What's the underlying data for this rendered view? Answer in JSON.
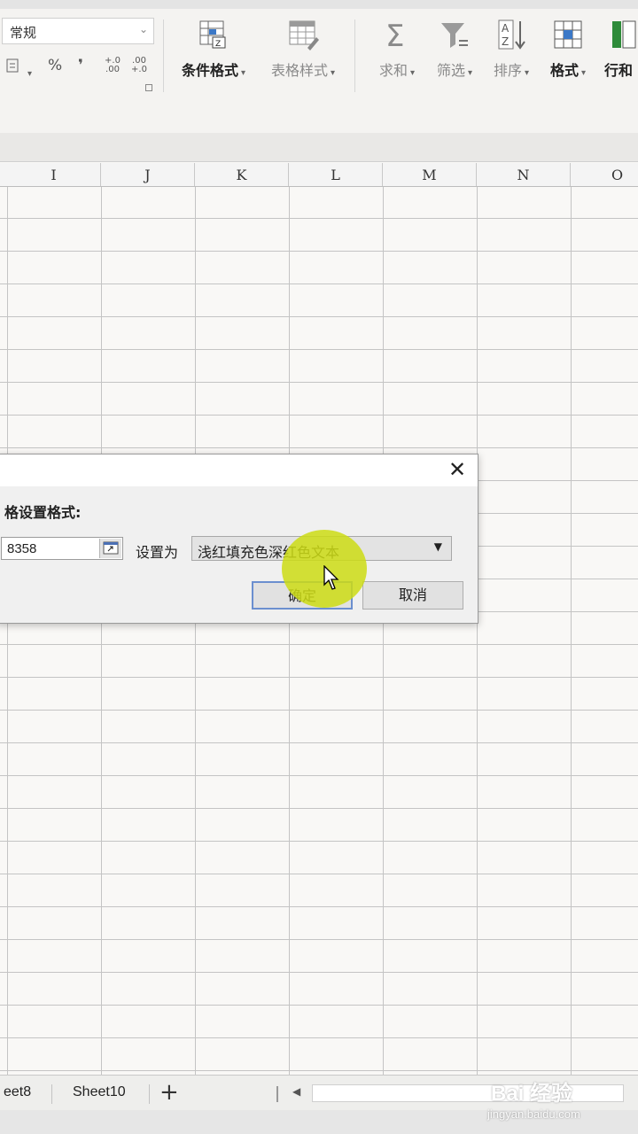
{
  "ribbon": {
    "number_format": "常规",
    "fmt_percent": "%",
    "fmt_comma": "❜",
    "fmt_inc_decimal": "+.0\n.00",
    "fmt_dec_decimal": ".00\n+.0",
    "conditional_format": "条件格式",
    "table_style": "表格样式",
    "sum": "求和",
    "filter": "筛选",
    "sort": "排序",
    "format": "格式",
    "rows_cols": "行和"
  },
  "columns": [
    "I",
    "J",
    "K",
    "L",
    "M",
    "N",
    "O"
  ],
  "dialog": {
    "prompt": "格设置格式:",
    "reference_value": "8358",
    "set_as_label": "设置为",
    "format_option": "浅红填充色深红色文本",
    "ok_label": "确定",
    "cancel_label": "取消"
  },
  "sheet_tabs": [
    "eet8",
    "Sheet10"
  ],
  "add_sheet": "+",
  "watermark": {
    "main": "Bai 经验",
    "sub": "jingyan.baidu.com"
  }
}
